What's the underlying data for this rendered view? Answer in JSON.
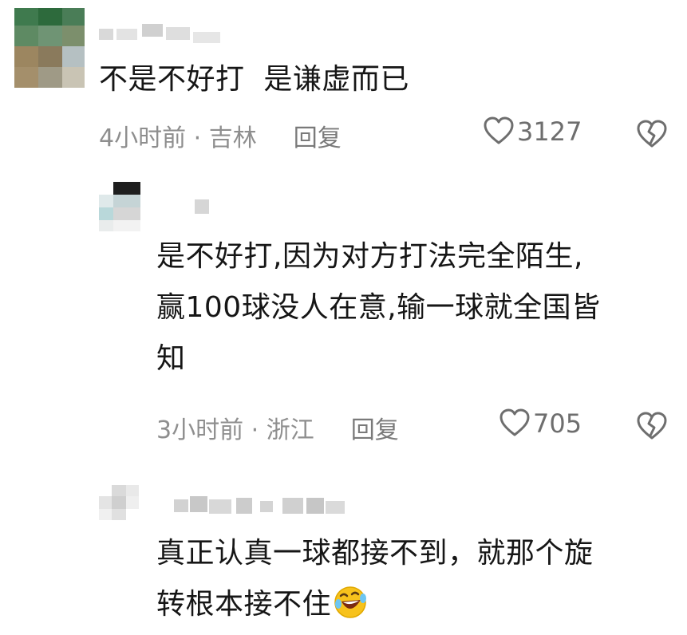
{
  "comments": [
    {
      "text_lines": [
        "不是不好打  是谦虚而已"
      ],
      "time": "4小时前",
      "location": "吉林",
      "reply_label": "回复",
      "likes": "3127"
    },
    {
      "text_lines": [
        "是不好打,因为对方打法完全陌生,",
        "赢100球没人在意,输一球就全国皆",
        "知"
      ],
      "time": "3小时前",
      "location": "浙江",
      "reply_label": "回复",
      "likes": "705"
    },
    {
      "text_lines": [
        "真正认真一球都接不到，就那个旋",
        "转根本接不住"
      ],
      "emoji": "rofl-emoji"
    }
  ],
  "meta_separator": " · ",
  "icons": {
    "like": "heart-outline-icon",
    "dislike": "broken-heart-icon"
  },
  "colors": {
    "text": "#161616",
    "meta": "#8e8e8e",
    "icon": "#6e6e6e"
  }
}
